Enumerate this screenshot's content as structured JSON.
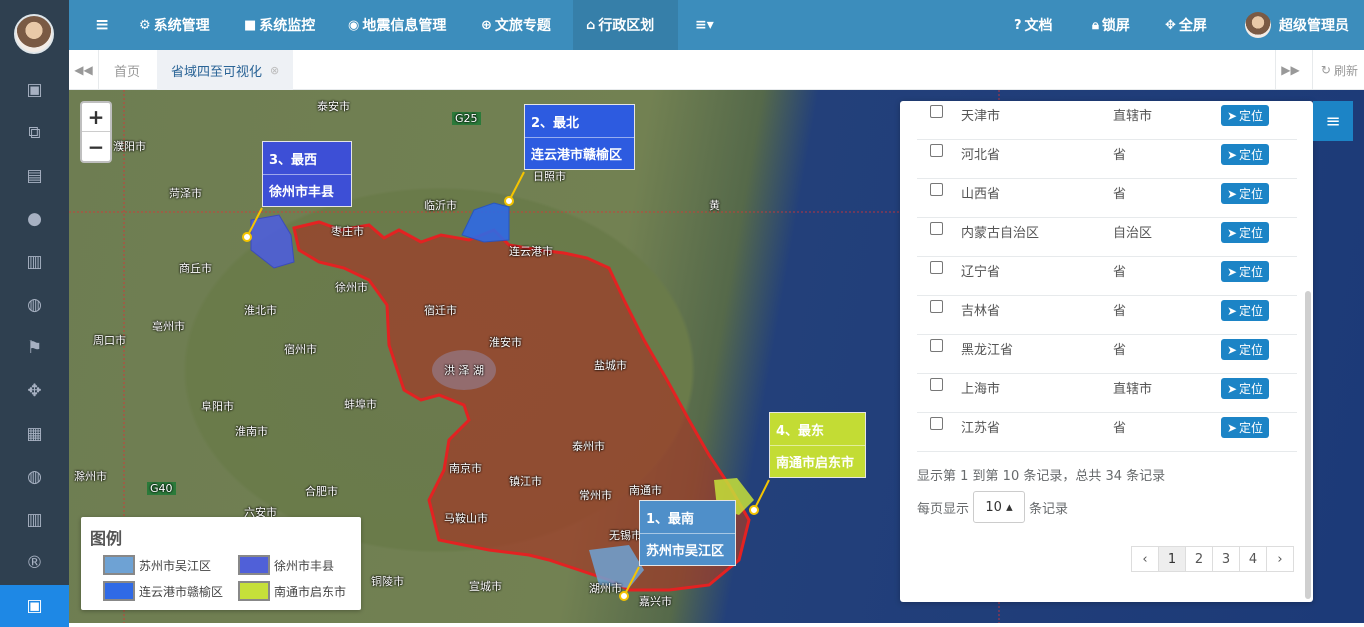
{
  "sidebar": {
    "icons": [
      "layout-icon",
      "diagram-icon",
      "map-icon",
      "marker-icon",
      "bar-chart-icon",
      "globe-icon",
      "flag-icon",
      "move-icon",
      "area-chart-icon",
      "globe-icon-2",
      "bar-chart-icon-2",
      "registered-icon",
      "layout-icon-active"
    ]
  },
  "topnav": {
    "menu_toggle": "≡",
    "items": [
      {
        "label": "系统管理",
        "icon": "gear-icon"
      },
      {
        "label": "系统监控",
        "icon": "video-icon"
      },
      {
        "label": "地震信息管理",
        "icon": "marker-icon"
      },
      {
        "label": "文旅专题",
        "icon": "globe-icon"
      },
      {
        "label": "行政区划",
        "icon": "bank-icon"
      },
      {
        "label": "≡▾",
        "icon": "more-icon"
      }
    ],
    "docs": "文档",
    "lock": "锁屏",
    "fullscreen": "全屏",
    "username": "超级管理员"
  },
  "tabbar": {
    "home": "首页",
    "active_tab": "省域四至可视化",
    "refresh": "刷新"
  },
  "map": {
    "zoom_in": "+",
    "zoom_out": "−",
    "callouts": [
      {
        "title": "1、最南",
        "name": "苏州市吴江区",
        "color": "#4f8fc9"
      },
      {
        "title": "2、最北",
        "name": "连云港市赣榆区",
        "color": "#2d5be0"
      },
      {
        "title": "3、最西",
        "name": "徐州市丰县",
        "color": "#3d4fd6"
      },
      {
        "title": "4、最东",
        "name": "南通市启东市",
        "color": "#c3dc34"
      }
    ],
    "places": [
      "泰安市",
      "濮阳市",
      "菏泽市",
      "日照市",
      "临沂市",
      "枣庄市",
      "连云港市",
      "商丘市",
      "徐州市",
      "宿迁市",
      "淮北市",
      "亳州市",
      "宿州市",
      "淮安市",
      "周口市",
      "盐城市",
      "洪 泽 湖",
      "阜阳市",
      "蚌埠市",
      "淮南市",
      "泰州市",
      "滁州市",
      "南京市",
      "镇江市",
      "常州市",
      "南通市",
      "合肥市",
      "马鞍山市",
      "无锡市",
      "六安市",
      "铜陵市",
      "宣城市",
      "湖州市",
      "嘉兴市",
      "黄"
    ],
    "road_labels": [
      "G25",
      "G40"
    ]
  },
  "legend": {
    "title": "图例",
    "items": [
      {
        "label": "苏州市吴江区",
        "color": "#6ea2d4"
      },
      {
        "label": "徐州市丰县",
        "color": "#5060d8"
      },
      {
        "label": "连云港市赣榆区",
        "color": "#2f6ae6"
      },
      {
        "label": "南通市启东市",
        "color": "#c6e03a"
      }
    ]
  },
  "table": {
    "rows": [
      {
        "name": "天津市",
        "type": "直辖市"
      },
      {
        "name": "河北省",
        "type": "省"
      },
      {
        "name": "山西省",
        "type": "省"
      },
      {
        "name": "内蒙古自治区",
        "type": "自治区"
      },
      {
        "name": "辽宁省",
        "type": "省"
      },
      {
        "name": "吉林省",
        "type": "省"
      },
      {
        "name": "黑龙江省",
        "type": "省"
      },
      {
        "name": "上海市",
        "type": "直辖市"
      },
      {
        "name": "江苏省",
        "type": "省"
      }
    ],
    "locate_label": "定位",
    "info": "显示第 1 到第 10 条记录，总共 34 条记录",
    "per_page_prefix": "每页显示",
    "per_page_value": "10 ▴",
    "per_page_suffix": "条记录",
    "pages": [
      "‹",
      "1",
      "2",
      "3",
      "4",
      "›"
    ]
  },
  "panel_toggle": "≡"
}
